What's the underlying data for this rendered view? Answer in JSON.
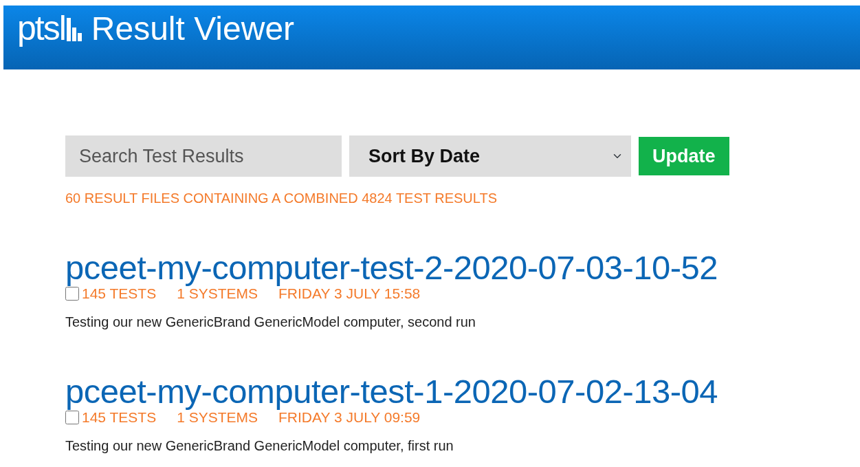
{
  "header": {
    "logo": "ptsl",
    "title": "Result Viewer"
  },
  "search": {
    "placeholder": "Search Test Results"
  },
  "sort": {
    "value": "Sort By Date"
  },
  "update_button": "Update",
  "summary": "60 RESULT FILES CONTAINING A COMBINED 4824 TEST RESULTS",
  "results": [
    {
      "title": "pceet-my-computer-test-2-2020-07-03-10-52",
      "checked": false,
      "tests": "145 TESTS",
      "systems": "1 SYSTEMS",
      "date": "FRIDAY 3 JULY 15:58",
      "description": "Testing our new GenericBrand GenericModel computer, second run"
    },
    {
      "title": "pceet-my-computer-test-1-2020-07-02-13-04",
      "checked": false,
      "tests": "145 TESTS",
      "systems": "1 SYSTEMS",
      "date": "FRIDAY 3 JULY 09:59",
      "description": "Testing our new GenericBrand GenericModel computer, first run"
    }
  ]
}
